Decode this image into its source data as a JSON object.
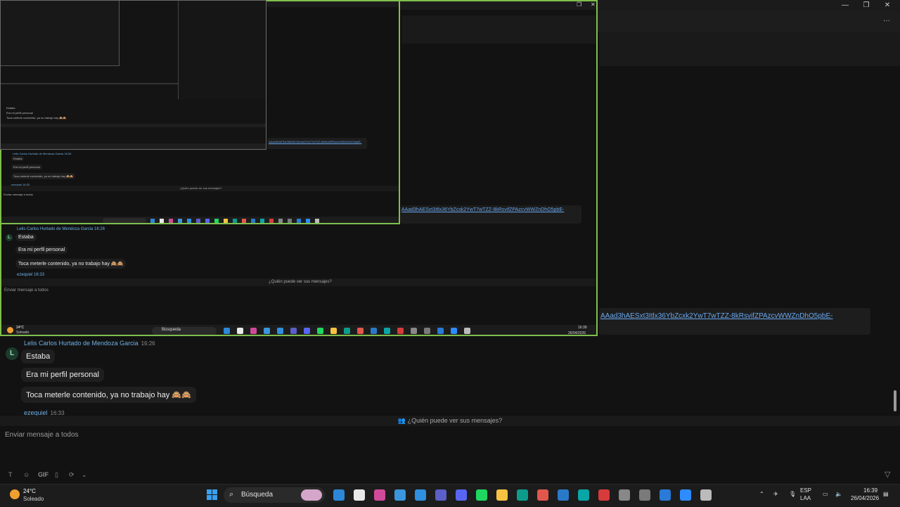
{
  "window": {
    "minimize": "—",
    "restore": "❐",
    "close": "✕",
    "more": "···"
  },
  "chat": {
    "link_text": "AAad3hAESxt3Itlx36YbZcxk2YwT7wTZZ-8kRsvifZPAzcvWWZnDhO5pbE-",
    "sender_name": "Lelis Carlos Hurtado de Mendoza Garcia",
    "sender_time": "16:26",
    "avatar_letter": "L",
    "messages": [
      "Estaba",
      "Era mi perfil personal",
      "Toca meterle contenido, ya no trabajo hay 🙈🙈"
    ],
    "reply_name": "ezequiel",
    "reply_time": "16:33",
    "privacy_notice": "¿Quién puede ver sus mensajes?",
    "composer_placeholder": "Enviar mensaje a todos",
    "composer_tools": [
      "T",
      "☺",
      "GIF",
      "▯",
      "⟳",
      "⌄"
    ]
  },
  "taskbar": {
    "weather_temp": "24°C",
    "weather_desc": "Soleado",
    "search_label": "Búsqueda",
    "lang_top": "ESP",
    "lang_bottom": "LAA",
    "clock_time": "16:39",
    "clock_date": "26/04/2026",
    "app_colors": [
      "#2b88d8",
      "#e8e8e8",
      "#d04a9a",
      "#3a96dd",
      "#2f8fe0",
      "#5b5fc7",
      "#5865f2",
      "#1ed760",
      "#f5c242",
      "#0e9c8a",
      "#e2574c",
      "#2a79c9",
      "#0aa6a6",
      "#d83b3b",
      "#888888",
      "#7a7a7a",
      "#2a7ad8",
      "#2d8cff",
      "#bbbbbb"
    ],
    "tray_icons": [
      "chevron-up",
      "wifi-off",
      "mic",
      "volume"
    ]
  },
  "nested": {
    "link_text": "AAad3hAESxt3Itlx36YbZcxk2YwT7wTZZ-8kRsvifZPAzcvWWZnDhO5pbE-",
    "privacy": "¿Quién puede ver sus mensajes?",
    "composer": "Enviar mensaje a todos",
    "sender": "Lelis Carlos Hurtado de Mendoza Garcia 16:26",
    "m1": "Estaba",
    "m2": "Era mi perfil personal",
    "m3": "Toca meterle contenido, ya no trabajo hay 🙈🙈",
    "reply": "ezequiel 16:33",
    "temp": "24°C",
    "desc": "Soleado",
    "search": "Búsqueda",
    "time": "16:39",
    "date": "26/04/2026"
  }
}
